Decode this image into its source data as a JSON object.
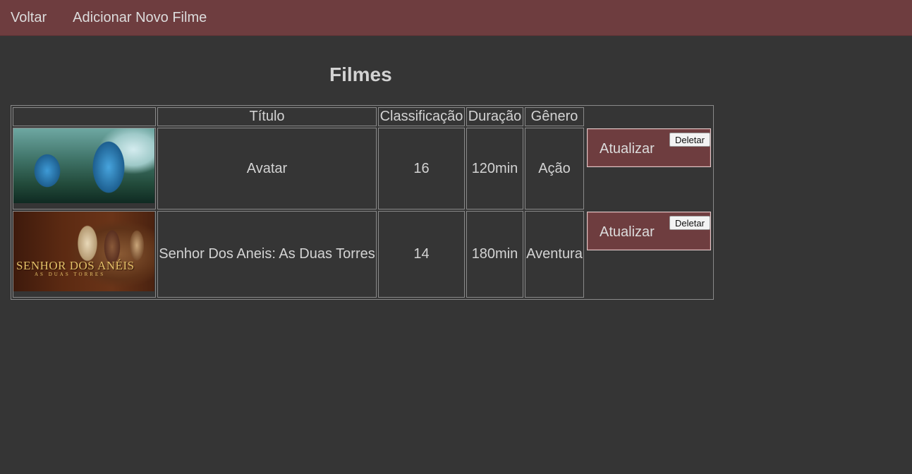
{
  "nav": {
    "back_label": "Voltar",
    "add_label": "Adicionar Novo Filme"
  },
  "page": {
    "title": "Filmes"
  },
  "table": {
    "headers": {
      "poster": "",
      "title": "Título",
      "classification": "Classificação",
      "duration": "Duração",
      "genre": "Gênero",
      "actions": ""
    },
    "rows": [
      {
        "poster_alt": "Avatar poster",
        "title": "Avatar",
        "classification": "16",
        "duration": "120min",
        "genre": "Ação",
        "update_label": "Atualizar",
        "delete_label": "Deletar"
      },
      {
        "poster_alt": "Senhor Dos Aneis: As Duas Torres poster",
        "poster_logo": "SENHOR DOS ANÉIS",
        "poster_logo_sub": "AS DUAS TORRES",
        "title": "Senhor Dos Aneis: As Duas Torres",
        "classification": "14",
        "duration": "180min",
        "genre": "Aventura",
        "update_label": "Atualizar",
        "delete_label": "Deletar"
      }
    ]
  },
  "colors": {
    "background": "#353535",
    "navbar": "#6e3d3f",
    "action_box": "#6e3d3f",
    "text": "#d3d3d3"
  }
}
